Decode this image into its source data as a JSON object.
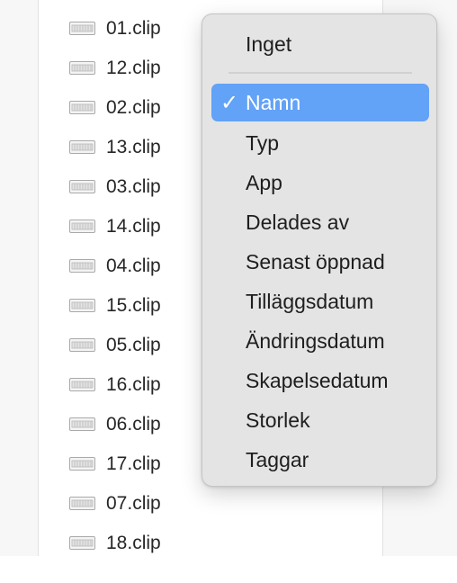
{
  "files": [
    {
      "name": "01.clip"
    },
    {
      "name": "12.clip"
    },
    {
      "name": "02.clip"
    },
    {
      "name": "13.clip"
    },
    {
      "name": "03.clip"
    },
    {
      "name": "14.clip"
    },
    {
      "name": "04.clip"
    },
    {
      "name": "15.clip"
    },
    {
      "name": "05.clip"
    },
    {
      "name": "16.clip"
    },
    {
      "name": "06.clip"
    },
    {
      "name": "17.clip"
    },
    {
      "name": "07.clip"
    },
    {
      "name": "18.clip"
    }
  ],
  "file_icon": "clip-file-icon",
  "sort_menu": {
    "items": [
      {
        "label": "Inget",
        "selected": false
      },
      {
        "label": "Namn",
        "selected": true
      },
      {
        "label": "Typ",
        "selected": false
      },
      {
        "label": "App",
        "selected": false
      },
      {
        "label": "Delades av",
        "selected": false
      },
      {
        "label": "Senast öppnad",
        "selected": false
      },
      {
        "label": "Tilläggsdatum",
        "selected": false
      },
      {
        "label": "Ändringsdatum",
        "selected": false
      },
      {
        "label": "Skapelsedatum",
        "selected": false
      },
      {
        "label": "Storlek",
        "selected": false
      },
      {
        "label": "Taggar",
        "selected": false
      }
    ],
    "check_glyph": "✓",
    "selected_color": "#62a2f7"
  }
}
